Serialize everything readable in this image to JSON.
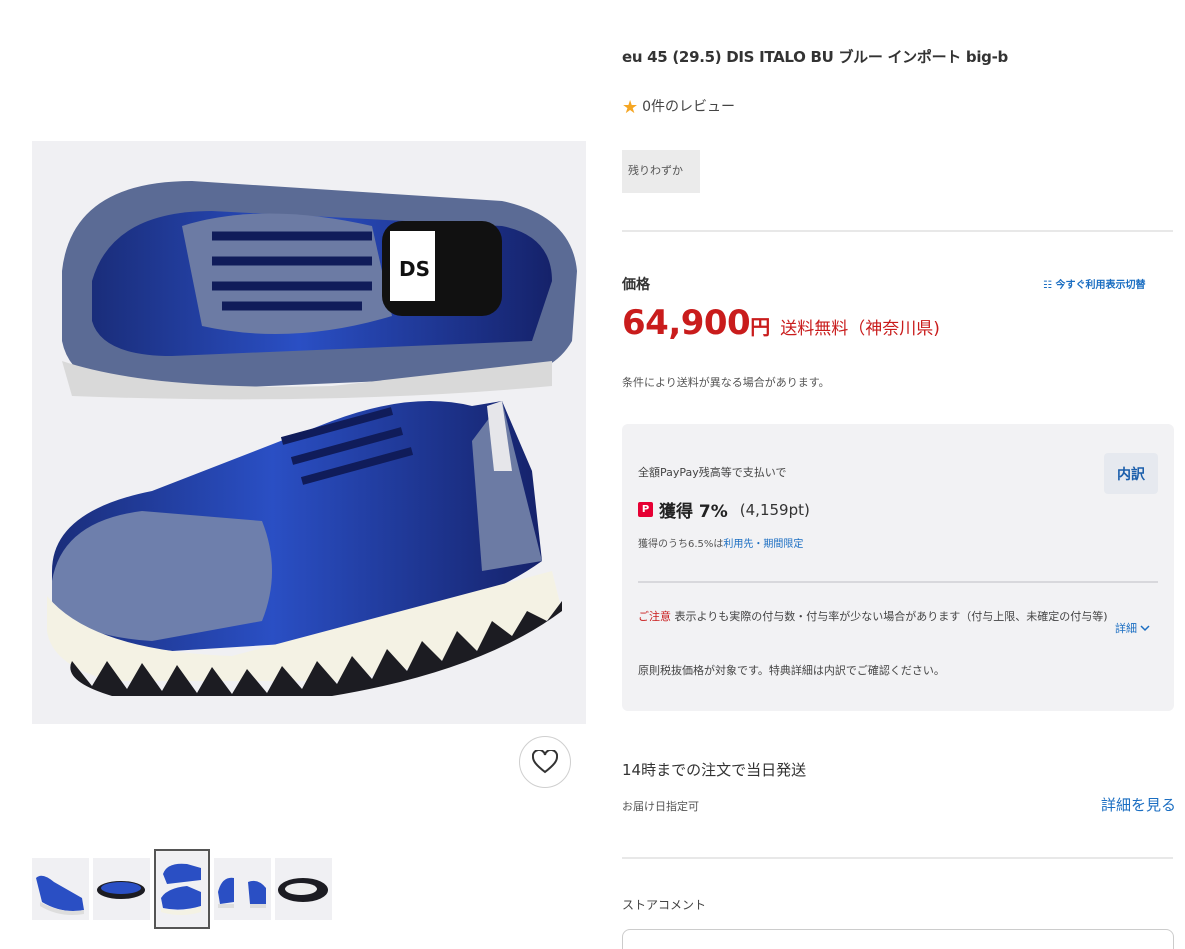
{
  "product": {
    "title": "eu 45 (29.5) DIS ITALO BU ブルー インポート big-b",
    "review_count_text": "0件のレビュー",
    "stock_badge": "残りわずか"
  },
  "price": {
    "label": "価格",
    "switch_link": "今すぐ利用表示切替",
    "amount": "64,900",
    "currency": "円",
    "shipping": "送料無料（神奈川県)",
    "shipping_note": "条件により送料が異なる場合があります。"
  },
  "paypay": {
    "lead": "全額PayPay残高等で支払いで",
    "breakdown_button": "内訳",
    "earn_label": "獲得 7%",
    "earn_points": "(4,159pt)",
    "earn_sub_prefix": "獲得のうち6.5%は",
    "earn_sub_link": "利用先・期間限定",
    "caution_label": "ご注意",
    "caution_text": "表示よりも実際の付与数・付与率が少ない場合があります（付与上限、未確定の付与等)",
    "detail_link": "詳細",
    "caution_note": "原則税抜価格が対象です。特典詳細は内訳でご確認ください。"
  },
  "shipping_info": {
    "same_day": "14時までの注文で当日発送",
    "delivery_date": "お届け日指定可",
    "see_more": "詳細を見る"
  },
  "store": {
    "comment_label": "ストアコメント"
  },
  "icons": {
    "star": "star-icon",
    "heart": "heart-icon",
    "paypay": "paypay-icon",
    "switch": "switch-icon",
    "chevron": "chevron-down-icon"
  },
  "colors": {
    "price_red": "#c91c1c",
    "link_blue": "#1b6ec2",
    "star_yellow": "#f5a623",
    "paypay_red": "#e60033"
  }
}
